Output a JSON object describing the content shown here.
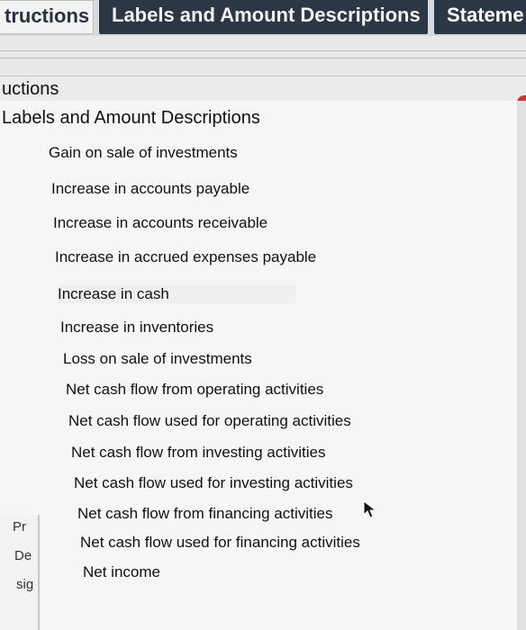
{
  "tabs": [
    {
      "label": "tructions"
    },
    {
      "label": "Labels and Amount Descriptions"
    },
    {
      "label": "Stateme"
    }
  ],
  "section": {
    "title": "uctions"
  },
  "dropdown": {
    "title": "Labels and Amount Descriptions",
    "items": [
      "Gain on sale of investments",
      "Increase in accounts payable",
      "Increase in accounts receivable",
      "Increase in accrued expenses payable",
      "Increase in cash",
      "Increase in inventories",
      "Loss on sale of investments",
      "Net cash flow from operating activities",
      "Net cash flow used for operating activities",
      "Net cash flow from investing activities",
      "Net cash flow used for investing activities",
      "Net cash flow from financing activities",
      "Net cash flow used for financing activities",
      "Net income"
    ]
  },
  "left_peek": [
    "Pr",
    "De",
    "sig"
  ],
  "colors": {
    "active_tab": "#2c3745",
    "inactive_tab": "#f3f3f3",
    "panel_bg": "#f6f6f6",
    "accent_red": "#d03434"
  },
  "icons": {
    "pointer": "mouse-pointer-icon"
  }
}
